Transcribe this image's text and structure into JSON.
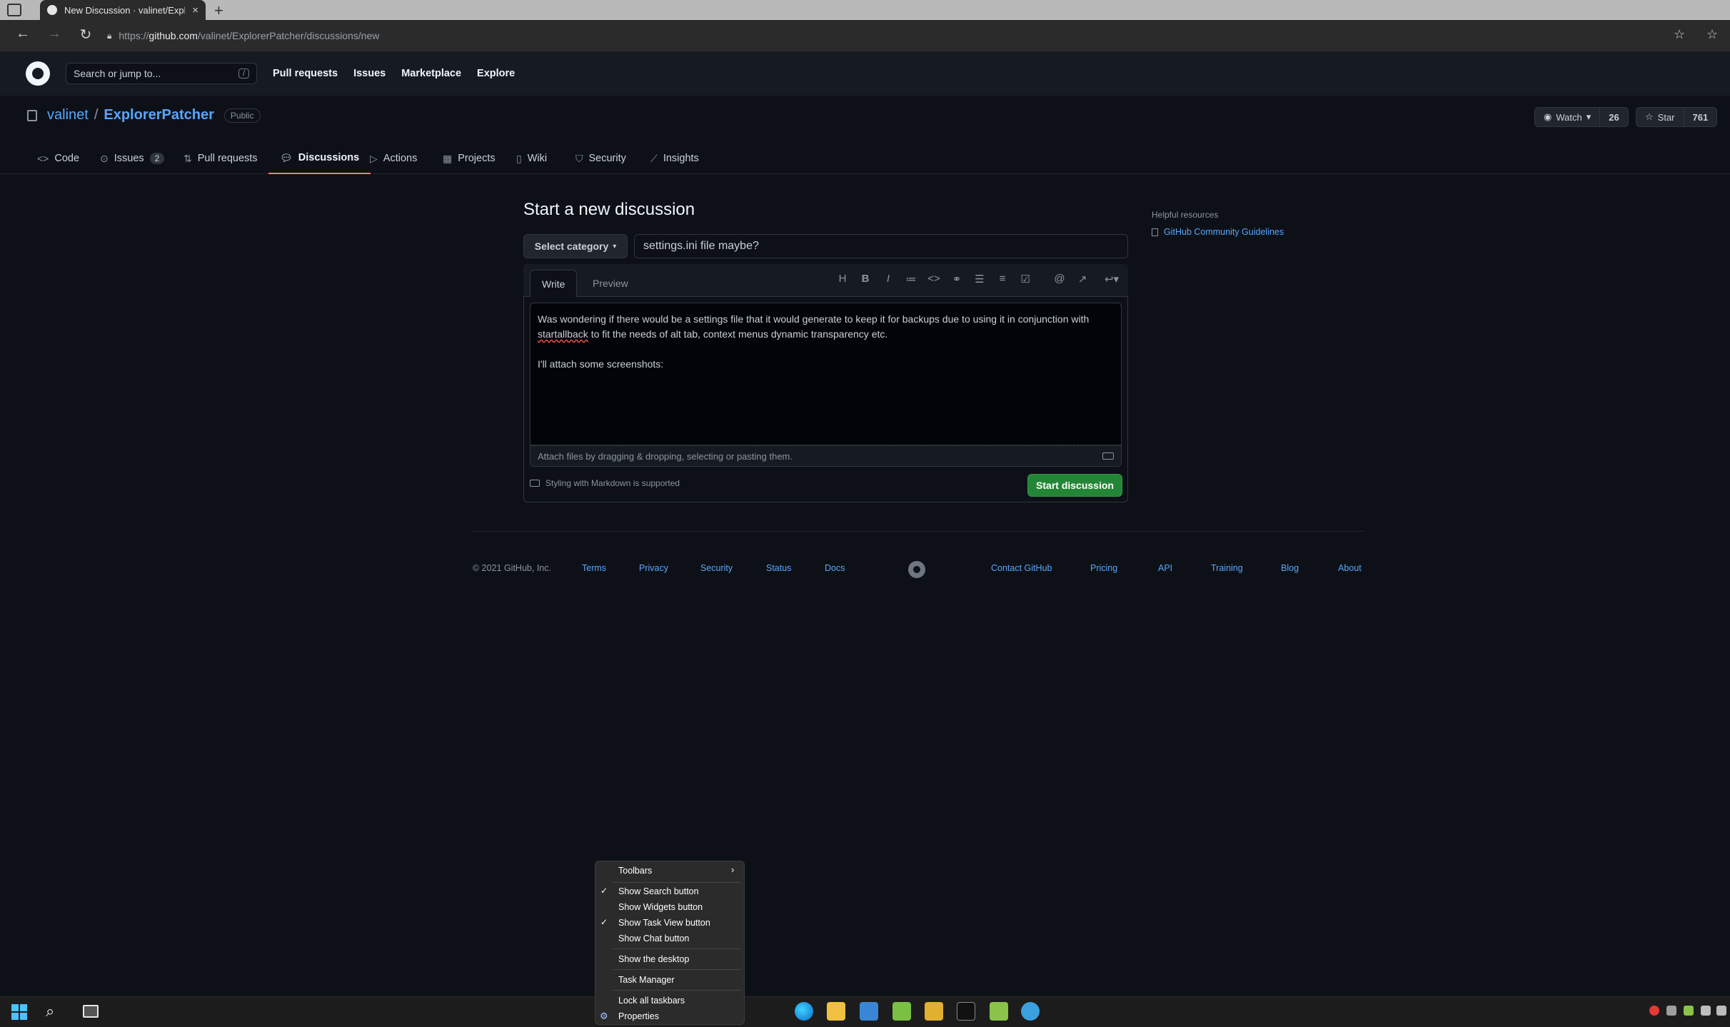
{
  "browser": {
    "tab_title": "New Discussion · valinet/Explore",
    "tab_close": "×",
    "new_tab": "+",
    "url_prefix": "https://",
    "url_host": "github.com",
    "url_path": "/valinet/ExplorerPatcher/discussions/new"
  },
  "header": {
    "search_placeholder": "Search or jump to...",
    "search_shortcut": "/",
    "nav": [
      "Pull requests",
      "Issues",
      "Marketplace",
      "Explore"
    ]
  },
  "repo": {
    "owner": "valinet",
    "separator": "/",
    "name": "ExplorerPatcher",
    "visibility": "Public",
    "watch_label": "Watch",
    "watch_count": "26",
    "star_label": "Star",
    "star_count": "761"
  },
  "tabs": [
    {
      "label": "Code",
      "icon": "code-icon"
    },
    {
      "label": "Issues",
      "icon": "issue-icon",
      "count": "2"
    },
    {
      "label": "Pull requests",
      "icon": "pull-request-icon"
    },
    {
      "label": "Discussions",
      "icon": "discussion-icon",
      "active": true
    },
    {
      "label": "Actions",
      "icon": "play-icon"
    },
    {
      "label": "Projects",
      "icon": "project-icon"
    },
    {
      "label": "Wiki",
      "icon": "book-icon"
    },
    {
      "label": "Security",
      "icon": "shield-icon"
    },
    {
      "label": "Insights",
      "icon": "graph-icon"
    }
  ],
  "form": {
    "page_title": "Start a new discussion",
    "category_label": "Select category",
    "title_value": "settings.ini file maybe?",
    "write_tab": "Write",
    "preview_tab": "Preview",
    "body_line1": "Was wondering if there would be a settings file that it would generate to keep it for backups due to using it in conjunction with",
    "body_misspelled": "startallback",
    "body_line2_rest": " to fit the needs of alt tab, context menus dynamic transparency etc.",
    "body_line3": "I'll attach some screenshots:",
    "attach_text": "Attach files by dragging & dropping, selecting or pasting them.",
    "markdown_note": "Styling with Markdown is supported",
    "submit_label": "Start discussion"
  },
  "sidebar": {
    "title": "Helpful resources",
    "link": "GitHub Community Guidelines"
  },
  "footer": {
    "copyright": "© 2021 GitHub, Inc.",
    "links_left": [
      "Terms",
      "Privacy",
      "Security",
      "Status",
      "Docs"
    ],
    "links_right": [
      "Contact GitHub",
      "Pricing",
      "API",
      "Training",
      "Blog",
      "About"
    ]
  },
  "context_menu": {
    "items": [
      {
        "label": "Toolbars",
        "submenu": true
      },
      {
        "label": "Show Search button",
        "checked": true
      },
      {
        "label": "Show Widgets button",
        "checked": false
      },
      {
        "label": "Show Task View button",
        "checked": true
      },
      {
        "label": "Show Chat button",
        "checked": false
      },
      {
        "label": "Show the desktop"
      },
      {
        "label": "Task Manager"
      },
      {
        "label": "Lock all taskbars"
      },
      {
        "label": "Properties"
      }
    ]
  },
  "colors": {
    "accent_link": "#58a6ff",
    "primary_button": "#238636",
    "active_tab_underline": "#f78166",
    "background": "#0d1117"
  }
}
